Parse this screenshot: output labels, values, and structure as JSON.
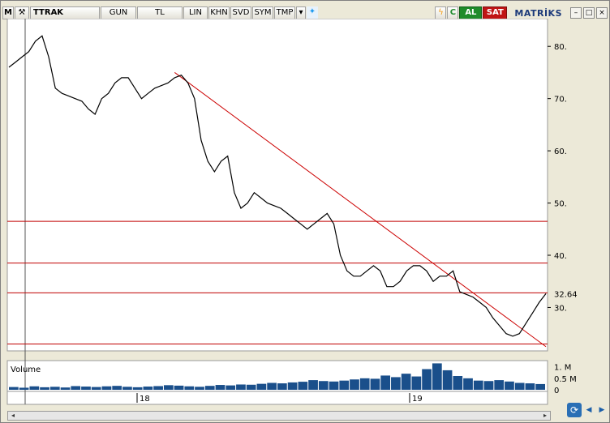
{
  "toolbar": {
    "menu_label": "M",
    "symbol": "TTRAK",
    "period": "GUN",
    "currency": "TL",
    "scale": "LIN",
    "khn": "KHN",
    "svd": "SVD",
    "sym": "SYM",
    "tmp": "TMP",
    "twitter_icon": "twitter-bird-icon",
    "lightning_icon": "lightning-icon",
    "c_label": "C",
    "buy_label": "AL",
    "sell_label": "SAT",
    "brand": "MATRİKS"
  },
  "colors": {
    "price_line": "#000000",
    "trendline": "#cc0000",
    "horizontal_levels": "#c00000",
    "volume_bars": "#1a4f8b",
    "buy": "#1f8b2a",
    "sell": "#c01414"
  },
  "chart_data": {
    "type": "line",
    "title": "TTRAK",
    "price_axis": {
      "ticks": [
        30,
        40,
        50,
        60,
        70,
        80
      ],
      "tick_labels": [
        "30.",
        "40.",
        "50.",
        "60.",
        "70.",
        "80."
      ],
      "ylim": [
        22,
        85
      ]
    },
    "last_price_label": "32.64",
    "last_price": 32.64,
    "x_labels": [
      "18",
      "19"
    ],
    "series": [
      {
        "values": [
          76,
          77,
          78,
          79,
          81,
          82,
          78,
          72,
          71,
          70.5,
          70,
          69.5,
          68,
          67,
          70,
          71,
          73,
          74,
          74,
          72,
          70,
          71,
          72,
          72.5,
          73,
          74,
          74.5,
          73,
          70,
          62,
          58,
          56,
          58,
          59,
          52,
          49,
          50,
          52,
          51,
          50,
          49.5,
          49,
          48,
          47,
          46,
          45,
          46,
          47,
          48,
          46,
          40,
          37,
          36,
          36,
          37,
          38,
          37,
          34,
          34,
          35,
          37,
          38,
          38,
          37,
          35,
          36,
          36,
          37,
          33,
          32.5,
          32,
          31,
          30,
          28,
          26.5,
          25,
          24.5,
          25,
          27,
          29,
          31,
          32.64
        ]
      }
    ],
    "trendline": {
      "from": 75,
      "to": 22.5
    },
    "horizontal_levels": [
      46.5,
      38.5,
      32.8,
      23
    ],
    "volume_panel": {
      "label": "Volume",
      "tick_labels": [
        "1. M",
        "0.5 M",
        "0"
      ],
      "ticks": [
        1000000,
        500000,
        0
      ],
      "values": [
        120000,
        90000,
        150000,
        110000,
        130000,
        100000,
        160000,
        140000,
        120000,
        150000,
        170000,
        130000,
        110000,
        140000,
        160000,
        200000,
        180000,
        150000,
        130000,
        170000,
        210000,
        190000,
        230000,
        220000,
        260000,
        300000,
        280000,
        320000,
        350000,
        420000,
        380000,
        360000,
        400000,
        450000,
        500000,
        480000,
        620000,
        550000,
        700000,
        580000,
        900000,
        1150000,
        850000,
        600000,
        500000,
        400000,
        380000,
        420000,
        360000,
        300000,
        280000,
        250000
      ]
    }
  }
}
